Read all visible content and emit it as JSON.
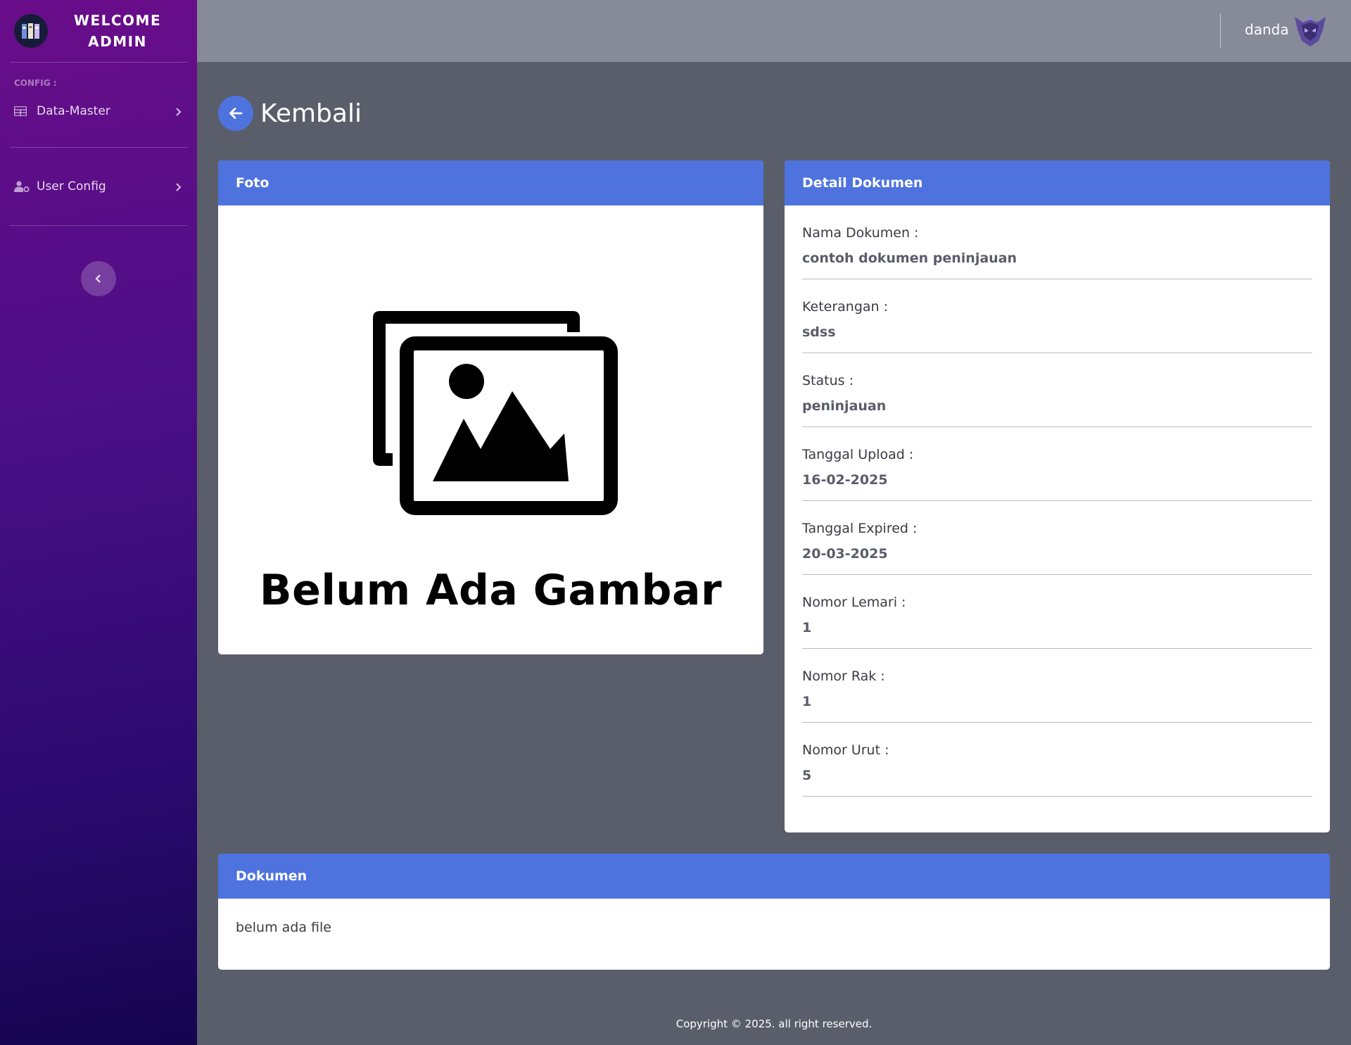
{
  "sidebar": {
    "brand_line1": "WELCOME",
    "brand_line2": "ADMIN",
    "heading": "CONFIG :",
    "items": [
      {
        "label": "Data-Master",
        "icon": "table-icon"
      },
      {
        "label": "User Config",
        "icon": "user-cog-icon"
      }
    ]
  },
  "topbar": {
    "username": "danda"
  },
  "back": {
    "label": "Kembali"
  },
  "foto": {
    "title": "Foto",
    "placeholder_text": "Belum Ada Gambar"
  },
  "detail": {
    "title": "Detail Dokumen",
    "rows": [
      {
        "label": "Nama Dokumen :",
        "value": "contoh dokumen peninjauan"
      },
      {
        "label": "Keterangan :",
        "value": "sdss"
      },
      {
        "label": "Status :",
        "value": "peninjauan"
      },
      {
        "label": "Tanggal Upload :",
        "value": "16-02-2025"
      },
      {
        "label": "Tanggal Expired :",
        "value": "20-03-2025"
      },
      {
        "label": "Nomor Lemari :",
        "value": "1"
      },
      {
        "label": "Nomor Rak :",
        "value": "1"
      },
      {
        "label": "Nomor Urut :",
        "value": "5"
      }
    ]
  },
  "dokumen": {
    "title": "Dokumen",
    "body": "belum ada file"
  },
  "footer": {
    "text": "Copyright © 2025. all right reserved."
  },
  "colors": {
    "primary": "#4e73df",
    "content_bg": "#5a5e6b",
    "topbar_bg": "#878a99"
  }
}
